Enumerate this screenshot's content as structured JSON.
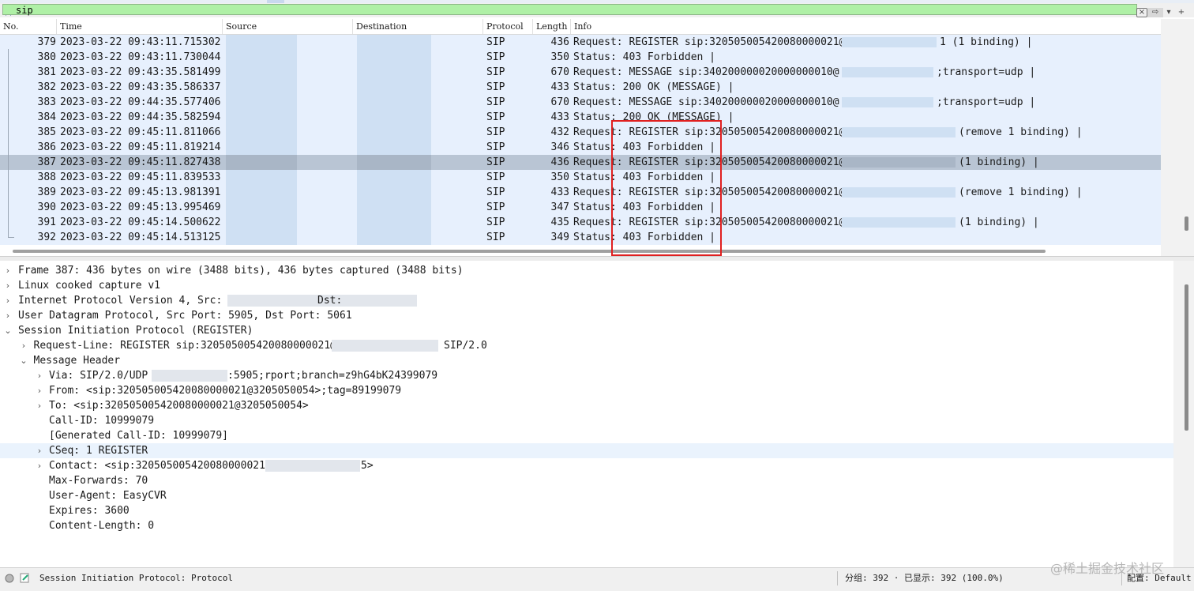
{
  "filter": {
    "value": "sip",
    "clear_label": "×",
    "arrow_label": "⇨",
    "dropdown_label": "▾"
  },
  "columns": [
    "No.",
    "Time",
    "Source",
    "Destination",
    "Protocol",
    "Length",
    "Info"
  ],
  "packets": [
    {
      "no": "379",
      "time": "2023-03-22 09:43:11.715302",
      "proto": "SIP",
      "len": "436",
      "info": "Request: REGISTER sip:320505005420080000021@",
      "tail": "1  (1 binding) |"
    },
    {
      "no": "380",
      "time": "2023-03-22 09:43:11.730044",
      "proto": "SIP",
      "len": "350",
      "info": "Status: 403 Forbidden |",
      "tail": ""
    },
    {
      "no": "381",
      "time": "2023-03-22 09:43:35.581499",
      "proto": "SIP",
      "len": "670",
      "info": "Request: MESSAGE sip:340200000020000000010@",
      "tail": ";transport=udp |"
    },
    {
      "no": "382",
      "time": "2023-03-22 09:43:35.586337",
      "proto": "SIP",
      "len": "433",
      "info": "Status: 200 OK (MESSAGE) |",
      "tail": ""
    },
    {
      "no": "383",
      "time": "2023-03-22 09:44:35.577406",
      "proto": "SIP",
      "len": "670",
      "info": "Request: MESSAGE sip:340200000020000000010@",
      "tail": ";transport=udp |"
    },
    {
      "no": "384",
      "time": "2023-03-22 09:44:35.582594",
      "proto": "SIP",
      "len": "433",
      "info": "Status: 200 OK (MESSAGE) |",
      "tail": ""
    },
    {
      "no": "385",
      "time": "2023-03-22 09:45:11.811066",
      "proto": "SIP",
      "len": "432",
      "info": "Request: REGISTER sip:320505005420080000021@",
      "tail": "(remove 1 binding) |"
    },
    {
      "no": "386",
      "time": "2023-03-22 09:45:11.819214",
      "proto": "SIP",
      "len": "346",
      "info": "Status: 403 Forbidden |",
      "tail": ""
    },
    {
      "no": "387",
      "time": "2023-03-22 09:45:11.827438",
      "proto": "SIP",
      "len": "436",
      "info": "Request: REGISTER sip:320505005420080000021@",
      "tail": "(1 binding) |"
    },
    {
      "no": "388",
      "time": "2023-03-22 09:45:11.839533",
      "proto": "SIP",
      "len": "350",
      "info": "Status: 403 Forbidden |",
      "tail": ""
    },
    {
      "no": "389",
      "time": "2023-03-22 09:45:13.981391",
      "proto": "SIP",
      "len": "433",
      "info": "Request: REGISTER sip:320505005420080000021@",
      "tail": "(remove 1 binding) |"
    },
    {
      "no": "390",
      "time": "2023-03-22 09:45:13.995469",
      "proto": "SIP",
      "len": "347",
      "info": "Status: 403 Forbidden |",
      "tail": ""
    },
    {
      "no": "391",
      "time": "2023-03-22 09:45:14.500622",
      "proto": "SIP",
      "len": "435",
      "info": "Request: REGISTER sip:320505005420080000021@1",
      "tail": "(1 binding) |"
    },
    {
      "no": "392",
      "time": "2023-03-22 09:45:14.513125",
      "proto": "SIP",
      "len": "349",
      "info": "Status: 403 Forbidden |",
      "tail": ""
    }
  ],
  "selected_packet": "387",
  "details": [
    {
      "text": "Frame 387: 436 bytes on wire (3488 bits), 436 bytes captured (3488 bits)",
      "arrow": "›"
    },
    {
      "text": "Linux cooked capture v1",
      "arrow": "›"
    },
    {
      "text": "Internet Protocol Version 4, Src:",
      "arrow": "›",
      "text2": "Dst:"
    },
    {
      "text": "User Datagram Protocol, Src Port: 5905, Dst Port: 5061",
      "arrow": "›"
    },
    {
      "text": "Session Initiation Protocol (REGISTER)",
      "arrow": "⌄"
    },
    {
      "text": "Request-Line: REGISTER sip:320505005420080000021@",
      "arrow": "›",
      "text2": "SIP/2.0"
    },
    {
      "text": "Message Header",
      "arrow": "⌄"
    },
    {
      "text": "Via: SIP/2.0/UDP",
      "arrow": "›",
      "text2": ":5905;rport;branch=z9hG4bK24399079"
    },
    {
      "text": "From: <sip:320505005420080000021@3205050054>;tag=89199079",
      "arrow": "›"
    },
    {
      "text": "To: <sip:320505005420080000021@3205050054>",
      "arrow": "›"
    },
    {
      "text": "Call-ID: 10999079",
      "arrow": ""
    },
    {
      "text": "[Generated Call-ID: 10999079]",
      "arrow": ""
    },
    {
      "text": "CSeq: 1 REGISTER",
      "arrow": "›"
    },
    {
      "text": "Contact: <sip:320505005420080000021@",
      "arrow": "›",
      "text2": "5>"
    },
    {
      "text": "Max-Forwards: 70",
      "arrow": ""
    },
    {
      "text": "User-Agent: EasyCVR",
      "arrow": ""
    },
    {
      "text": "Expires: 3600",
      "arrow": ""
    },
    {
      "text": "Content-Length: 0",
      "arrow": ""
    }
  ],
  "status": {
    "field": "Session Initiation Protocol: Protocol",
    "packets": "分组: 392 · 已显示: 392 (100.0%)",
    "profile": "配置: Default"
  },
  "watermark": "@稀土掘金技术社区",
  "colors": {
    "filter_bg": "#aff0a6",
    "row_bg": "#e7f0fd",
    "selected_row": "#b9c5d4",
    "highlight_box": "#e02020"
  }
}
